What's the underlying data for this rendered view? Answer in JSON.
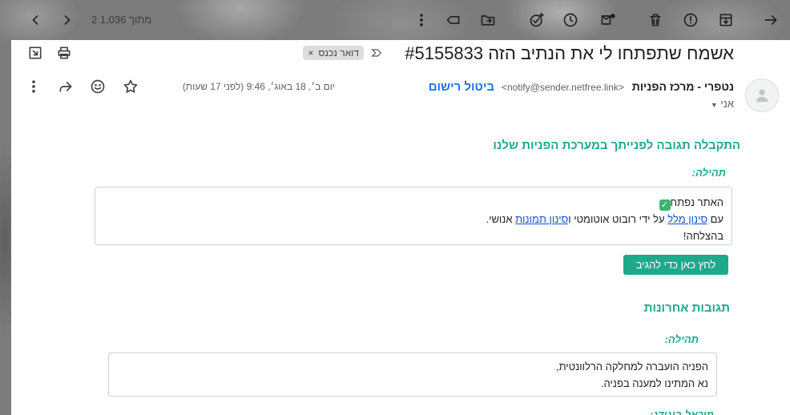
{
  "toolbar": {
    "pager": "2 מתוך 1,036",
    "icons": [
      "back-arrow-icon",
      "archive-icon",
      "report-spam-icon",
      "delete-icon",
      "mark-unread-icon",
      "snooze-icon",
      "add-task-icon",
      "move-to-icon",
      "label-icon",
      "more-vert-icon",
      "newer-icon",
      "older-icon"
    ]
  },
  "email": {
    "subject": "אשמח שתפתחו לי את הנתיב הזה #5155833",
    "label_chip": "דואר נכנס",
    "label_chip_remove": "×",
    "sender_name": "נטפרי - מרכז הפניות",
    "sender_email": "<notify@sender.netfree.link>",
    "unsubscribe": "ביטול רישום",
    "to": "אני",
    "date": "יום ב׳, 18 באוג׳, 9:46 (לפני 17 שעות)"
  },
  "body": {
    "section1_title": "התקבלה תגובה לפנייתך במערכת הפניות שלנו",
    "role1": "תהילה:",
    "msg1": {
      "line1": "האתר נפתח",
      "line2_a": "עם ",
      "link1": "סינון מלל",
      "line2_b": " על ידי רובוט אוטומטי ו",
      "link2": "סינון תמונות",
      "line2_c": " אנושי.",
      "line3": "בהצלחה!"
    },
    "reply_button": "לחץ כאן כדי להגיב",
    "section2_title": "תגובות אחרונות",
    "role2": "תהילה:",
    "msg2": {
      "line1": "הפניה הועברה למחלקה הרלוונטית,",
      "line2": "נא המתינו למענה בפניה."
    },
    "role3_cut": "מיכאל בוגודג:"
  },
  "colors": {
    "accent": "#1ea98b",
    "link": "#1155cc",
    "unsubscribe": "#1a73e8"
  }
}
